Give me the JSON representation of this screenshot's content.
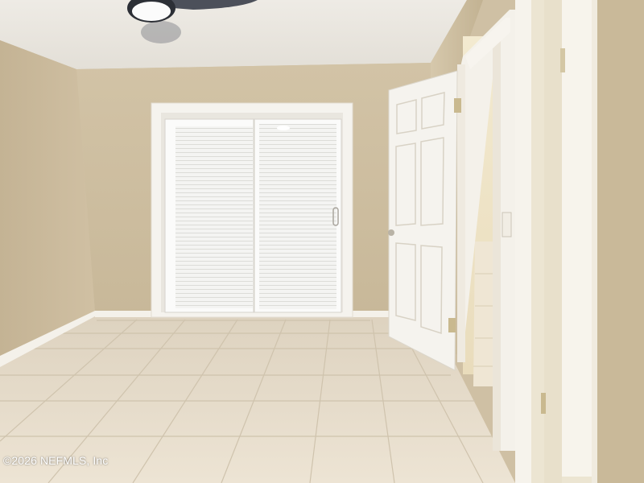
{
  "photo": {
    "subject": "empty bedroom with sliding glass door, open panel door and tile floor",
    "watermark_text": "©2026 NEFMLS, Inc",
    "colors": {
      "wall": "#cdbd9f",
      "wall_shadow": "#b8a789",
      "ceiling": "#ece9e2",
      "floor": "#e6dccb",
      "grout": "#cbbfa9",
      "trim": "#f6f4ee",
      "blinds": "#f2f2f2",
      "door": "#f4f2ed",
      "hinge": "#c9b98f"
    }
  }
}
